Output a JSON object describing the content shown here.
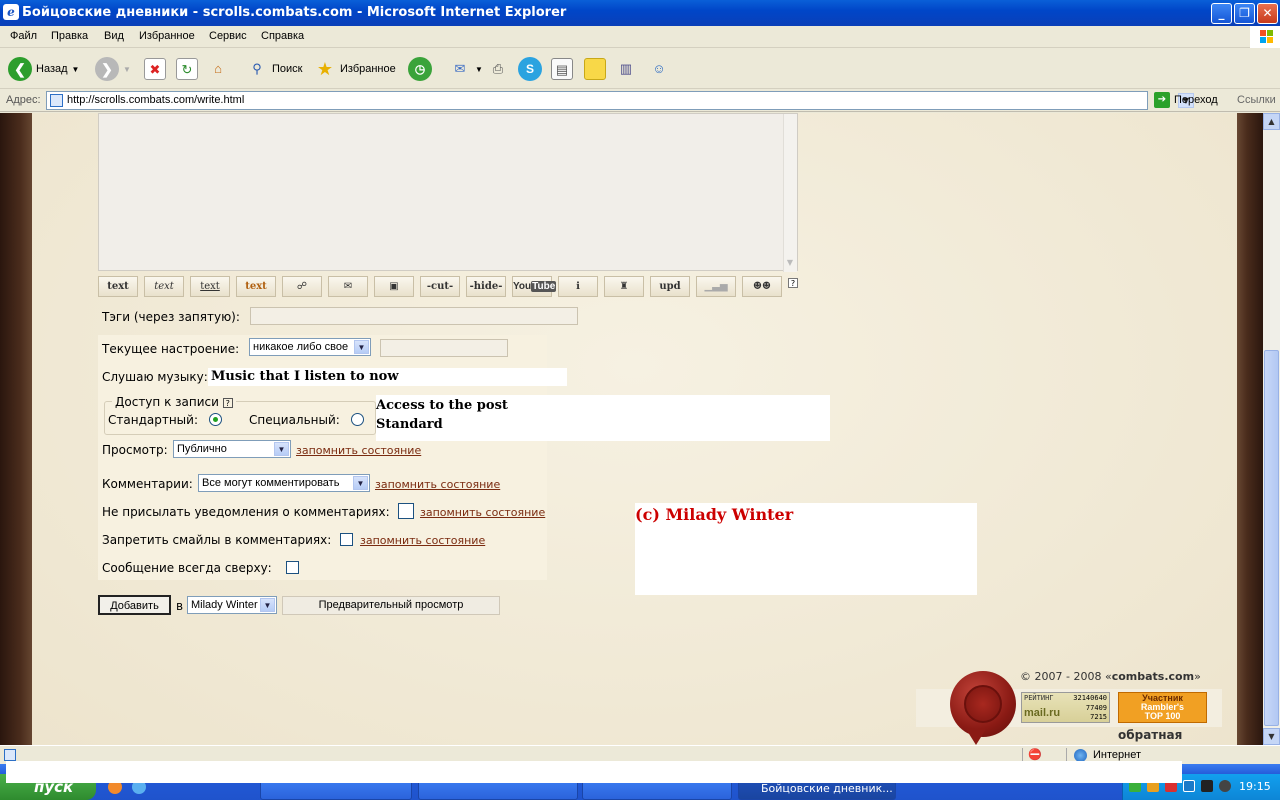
{
  "window": {
    "title": "Бойцовские дневники - scrolls.combats.com - Microsoft Internet Explorer",
    "minimize": "_",
    "restore": "❐",
    "close": "✕"
  },
  "menu": [
    "Файл",
    "Правка",
    "Вид",
    "Избранное",
    "Сервис",
    "Справка"
  ],
  "toolbar": {
    "back": "Назад",
    "search": "Поиск",
    "favorites": "Избранное"
  },
  "address": {
    "label": "Адрес:",
    "url": "http://scrolls.combats.com/write.html",
    "go": "Переход",
    "links": "Ссылки"
  },
  "format_buttons": [
    "text",
    "text",
    "text",
    "text",
    "",
    "",
    "",
    "-cut-",
    "-hide-",
    "You",
    "",
    "",
    "upd",
    "",
    ""
  ],
  "form": {
    "tags_label": "Тэги (через запятую):",
    "mood_label": "Текущее настроение:",
    "mood_select": "никакое либо свое",
    "music_label": "Слушаю музыку:",
    "music_value": "Music that I listen to now",
    "access_legend": "Доступ к записи",
    "access_standard": "Стандартный:",
    "access_special": "Специальный:",
    "access_note_line1": "Access to the post",
    "access_note_line2": "Standard",
    "view_label": "Просмотр:",
    "view_select": "Публично",
    "remember": "запомнить состояние",
    "comments_label": "Комментарии:",
    "comments_select": "Все могут комментировать",
    "notify_label": "Не присылать уведомления о комментариях:",
    "smiles_label": "Запретить смайлы в комментариях:",
    "top_label": "Сообщение всегда сверху:",
    "submit": "Добавить",
    "in": "в",
    "journal_select": "Milady Winter",
    "preview": "Предварительный просмотр"
  },
  "signature": "(c) Milady Winter",
  "footer": {
    "copyright_prefix": "© 2007 - 2008 «",
    "copyright_site": "combats.com",
    "copyright_suffix": "»",
    "rating_label": "РЕЙТИНГ",
    "rating_values": [
      "32140640",
      "77409",
      "7215"
    ],
    "mailru": "mail.ru",
    "rambler_line1": "Участник",
    "rambler_line2": "Rambler's",
    "rambler_line3": "TOP 100",
    "feedback": "обратная связь"
  },
  "status": {
    "zone": "Интернет"
  },
  "taskbar": {
    "start": "пуск",
    "tasks": [
      "",
      "",
      "",
      "Бойцовские дневник..."
    ],
    "clock": "19:15"
  },
  "colors": {
    "accent_link": "#7a2b10",
    "signature": "#cc0000",
    "parchment": "#f1ebd9"
  }
}
